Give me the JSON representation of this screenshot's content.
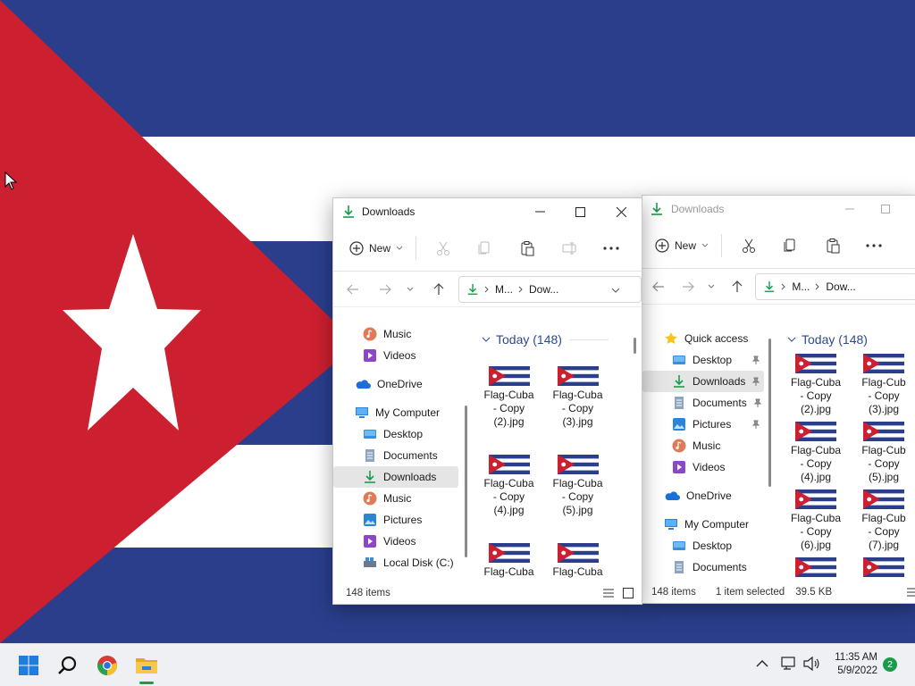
{
  "window_left": {
    "title": "Downloads",
    "toolbar": {
      "new_label": "New"
    },
    "address": {
      "crumb1": "M...",
      "crumb2": "Dow..."
    },
    "sidebar": [
      {
        "label": "Music",
        "icon": "music-icon"
      },
      {
        "label": "Videos",
        "icon": "videos-icon"
      },
      {
        "label": "OneDrive",
        "icon": "onedrive-icon"
      },
      {
        "label": "My Computer",
        "icon": "computer-icon"
      },
      {
        "label": "Desktop",
        "icon": "desktop-icon"
      },
      {
        "label": "Documents",
        "icon": "documents-icon"
      },
      {
        "label": "Downloads",
        "icon": "downloads-icon",
        "selected": true
      },
      {
        "label": "Music",
        "icon": "music-icon"
      },
      {
        "label": "Pictures",
        "icon": "pictures-icon"
      },
      {
        "label": "Videos",
        "icon": "videos-icon"
      },
      {
        "label": "Local Disk (C:)",
        "icon": "disk-icon"
      }
    ],
    "group_header": "Today (148)",
    "files": [
      {
        "l1": "Flag-Cuba",
        "l2": "- Copy",
        "l3": "(2).jpg"
      },
      {
        "l1": "Flag-Cuba",
        "l2": "- Copy",
        "l3": "(3).jpg"
      },
      {
        "l1": "Flag-Cuba",
        "l2": "- Copy",
        "l3": "(4).jpg"
      },
      {
        "l1": "Flag-Cuba",
        "l2": "- Copy",
        "l3": "(5).jpg"
      },
      {
        "l1": "Flag-Cuba",
        "l2": "",
        "l3": ""
      },
      {
        "l1": "Flag-Cuba",
        "l2": "",
        "l3": ""
      }
    ],
    "status": {
      "items": "148 items"
    }
  },
  "window_right": {
    "title": "Downloads",
    "toolbar": {
      "new_label": "New"
    },
    "address": {
      "crumb1": "M...",
      "crumb2": "Dow..."
    },
    "sidebar": [
      {
        "label": "Quick access",
        "icon": "star-icon"
      },
      {
        "label": "Desktop",
        "icon": "desktop-icon",
        "pinned": true
      },
      {
        "label": "Downloads",
        "icon": "downloads-icon",
        "pinned": true,
        "selected": true
      },
      {
        "label": "Documents",
        "icon": "documents-icon",
        "pinned": true
      },
      {
        "label": "Pictures",
        "icon": "pictures-icon",
        "pinned": true
      },
      {
        "label": "Music",
        "icon": "music-icon"
      },
      {
        "label": "Videos",
        "icon": "videos-icon"
      },
      {
        "label": "OneDrive",
        "icon": "onedrive-icon"
      },
      {
        "label": "My Computer",
        "icon": "computer-icon"
      },
      {
        "label": "Desktop",
        "icon": "desktop-icon"
      },
      {
        "label": "Documents",
        "icon": "documents-icon"
      }
    ],
    "group_header": "Today (148)",
    "files": [
      {
        "l1": "Flag-Cuba",
        "l2": "- Copy",
        "l3": "(2).jpg"
      },
      {
        "l1": "Flag-Cub",
        "l2": "- Copy",
        "l3": "(3).jpg"
      },
      {
        "l1": "Flag-Cuba",
        "l2": "- Copy",
        "l3": "(4).jpg"
      },
      {
        "l1": "Flag-Cub",
        "l2": "- Copy",
        "l3": "(5).jpg"
      },
      {
        "l1": "Flag-Cuba",
        "l2": "- Copy",
        "l3": "(6).jpg"
      },
      {
        "l1": "Flag-Cub",
        "l2": "- Copy",
        "l3": "(7).jpg"
      },
      {
        "l1": "",
        "l2": "",
        "l3": ""
      },
      {
        "l1": "",
        "l2": "",
        "l3": ""
      }
    ],
    "status": {
      "items": "148 items",
      "selected": "1 item selected",
      "size": "39.5 KB"
    }
  },
  "taskbar": {
    "time": "11:35 AM",
    "date": "5/9/2022",
    "notification_count": "2",
    "apps": [
      "start-icon",
      "search-icon",
      "chrome-icon",
      "file-explorer-icon"
    ]
  },
  "colors": {
    "flag_blue": "#2a3e8c",
    "flag_red": "#cc1f2f",
    "flag_white": "#ffffff",
    "accent": "#1a9b4c",
    "selection": "#e5e5e5"
  }
}
